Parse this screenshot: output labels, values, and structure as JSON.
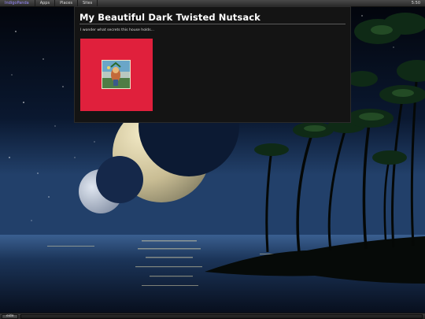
{
  "top_panel": {
    "app_menu_label": "IndigoPanda",
    "menus": [
      "Apps",
      "Places",
      "Sites"
    ],
    "clock": "5:50"
  },
  "window": {
    "title": "My Beautiful Dark Twisted Nutsack",
    "subtitle": "I wonder what secrets this house holds...",
    "cover_background": "#e0203c"
  },
  "bottom_panel": {
    "task_label": "eide"
  },
  "colors": {
    "accent": "#9a8cff",
    "window_bg": "#141414"
  }
}
